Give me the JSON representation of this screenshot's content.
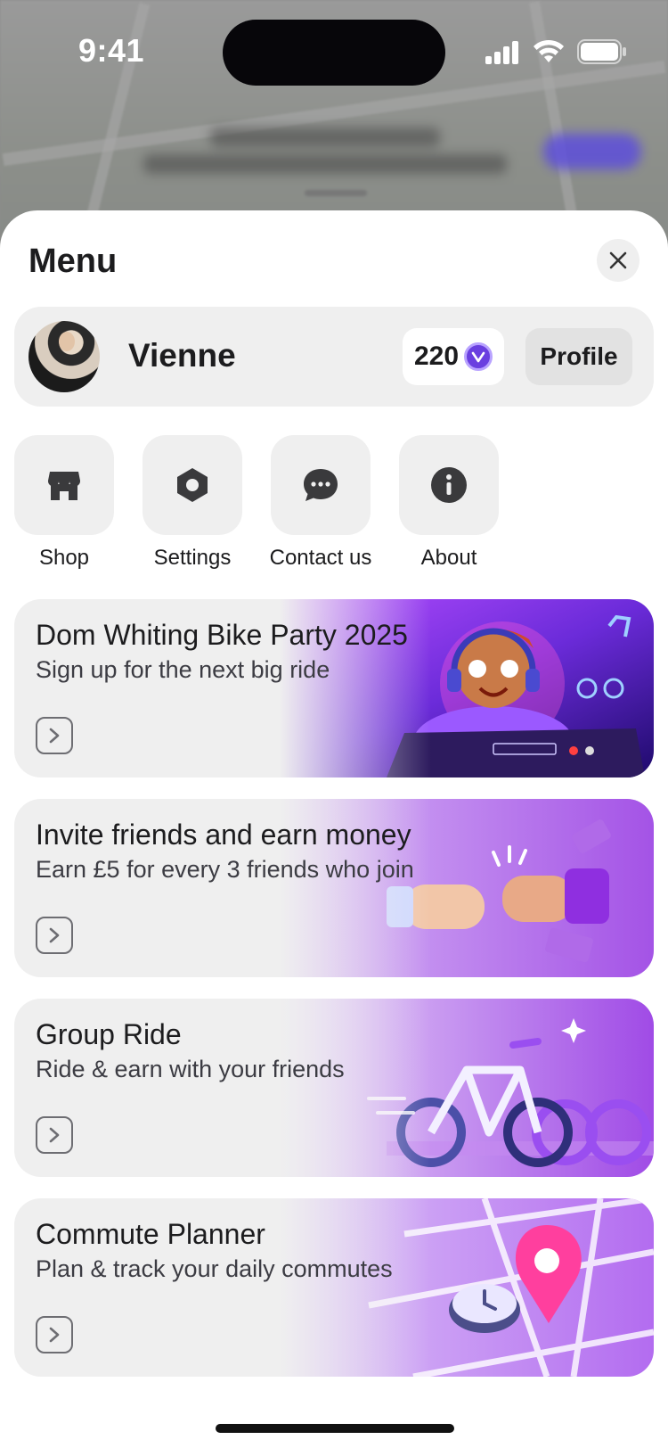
{
  "status": {
    "time": "9:41"
  },
  "menu": {
    "title": "Menu",
    "close_icon": "close-icon"
  },
  "profile": {
    "name": "Vienne",
    "points": "220",
    "profile_button": "Profile"
  },
  "quick_actions": [
    {
      "label": "Shop",
      "icon": "store-icon"
    },
    {
      "label": "Settings",
      "icon": "hexagon-settings-icon"
    },
    {
      "label": "Contact us",
      "icon": "chat-bubble-icon"
    },
    {
      "label": "About",
      "icon": "info-icon"
    }
  ],
  "cards": [
    {
      "title": "Dom Whiting Bike Party 2025",
      "subtitle": "Sign up for the next big ride"
    },
    {
      "title": "Invite friends and earn money",
      "subtitle": "Earn £5 for every 3 friends who join"
    },
    {
      "title": "Group Ride",
      "subtitle": "Ride & earn with your friends"
    },
    {
      "title": "Commute Planner",
      "subtitle": "Plan & track your daily commutes"
    }
  ],
  "colors": {
    "accent": "#6a3fe0",
    "card_bg": "#efefef",
    "sheet_bg": "#ffffff"
  }
}
